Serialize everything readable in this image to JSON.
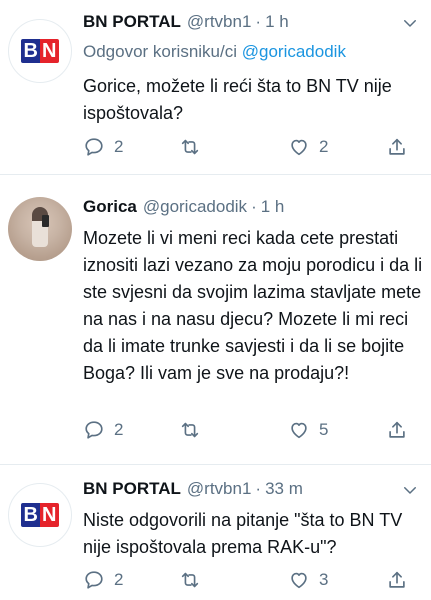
{
  "tweets": [
    {
      "name": "BN PORTAL",
      "handle": "@rtvbn1",
      "sep": "·",
      "time": "1 h",
      "reply_prefix": "Odgovor korisniku/ci",
      "reply_mention": "@goricadodik",
      "text": "Gorice, možete li reći šta to BN TV nije ispoštovala?",
      "replies": "2",
      "retweets": "",
      "likes": "2"
    },
    {
      "name": "Gorica",
      "handle": "@goricadodik",
      "sep": "·",
      "time": "1 h",
      "text": "Mozete li vi meni reci kada cete prestati iznositi lazi vezano za moju porodicu i da li ste svjesni da svojim lazima stavljate mete na nas i na nasu djecu? Mozete li mi reci da li imate trunke savjesti i da li se bojite Boga? Ili vam je sve na prodaju?!",
      "replies": "2",
      "retweets": "",
      "likes": "5"
    },
    {
      "name": "BN PORTAL",
      "handle": "@rtvbn1",
      "sep": "·",
      "time": "33 m",
      "text": "Niste odgovorili na pitanje \"šta to BN TV nije ispoštovala prema RAK-u\"?",
      "replies": "2",
      "retweets": "",
      "likes": "3"
    }
  ],
  "logo": {
    "b": "B",
    "n": "N"
  },
  "icons": {
    "reply": "speech-bubble-icon",
    "retweet": "retweet-icon",
    "like": "heart-icon",
    "share": "share-upload-icon",
    "more": "chevron-down-icon"
  },
  "colors": {
    "text": "#0f1419",
    "secondary": "#5b7083",
    "link": "#1b95e0",
    "bn_blue": "#1f2f8f",
    "bn_red": "#e5232b"
  }
}
